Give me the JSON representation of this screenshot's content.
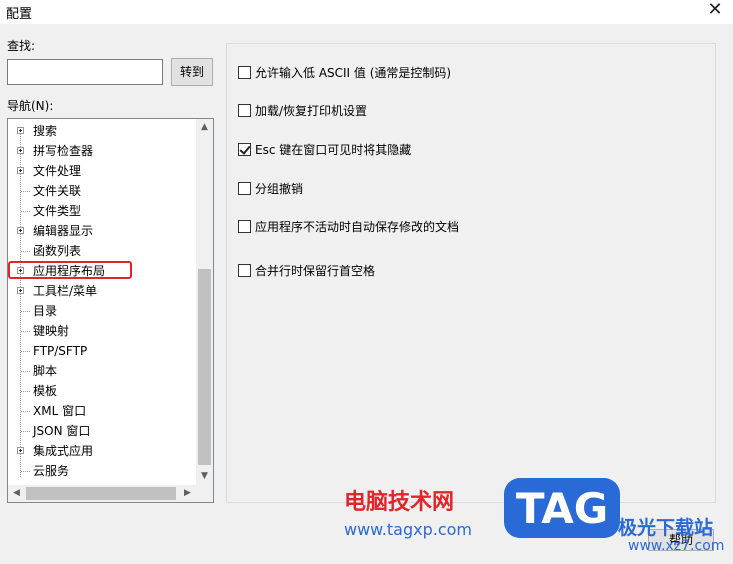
{
  "window": {
    "title": "配置",
    "close_glyph": "✕"
  },
  "search": {
    "label": "查找:",
    "value": "",
    "goto_button": "转到"
  },
  "nav": {
    "label": "导航(N):",
    "items": [
      {
        "label": "搜索",
        "expandable": true
      },
      {
        "label": "拼写检查器",
        "expandable": true
      },
      {
        "label": "文件处理",
        "expandable": true
      },
      {
        "label": "文件关联",
        "expandable": false
      },
      {
        "label": "文件类型",
        "expandable": false
      },
      {
        "label": "编辑器显示",
        "expandable": true
      },
      {
        "label": "函数列表",
        "expandable": false
      },
      {
        "label": "应用程序布局",
        "expandable": true,
        "highlighted": true
      },
      {
        "label": "工具栏/菜单",
        "expandable": true
      },
      {
        "label": "目录",
        "expandable": false
      },
      {
        "label": "键映射",
        "expandable": false
      },
      {
        "label": "FTP/SFTP",
        "expandable": false
      },
      {
        "label": "脚本",
        "expandable": false
      },
      {
        "label": "模板",
        "expandable": false
      },
      {
        "label": "XML 窗口",
        "expandable": false
      },
      {
        "label": "JSON 窗口",
        "expandable": false
      },
      {
        "label": "集成式应用",
        "expandable": true
      },
      {
        "label": "云服务",
        "expandable": false
      }
    ]
  },
  "options": [
    {
      "label": "允许输入低 ASCII 值 (通常是控制码)",
      "checked": false
    },
    {
      "label": "加载/恢复打印机设置",
      "checked": false
    },
    {
      "label": "Esc 键在窗口可见时将其隐藏",
      "checked": true
    },
    {
      "label": "分组撤销",
      "checked": false
    },
    {
      "label": "应用程序不活动时自动保存修改的文档",
      "checked": false
    },
    {
      "label": "合并行时保留行首空格",
      "checked": false
    }
  ],
  "footer": {
    "help_button": "帮助"
  },
  "watermark": {
    "site_cn": "电脑技术网",
    "site_url": "www.tagxp.com",
    "tag_text": "TAG",
    "site2_cn": "极光下载站",
    "site2_url": "www.xz7.com"
  },
  "colors": {
    "highlight": "#e0262a",
    "tag_blue": "#2a6ad6"
  }
}
